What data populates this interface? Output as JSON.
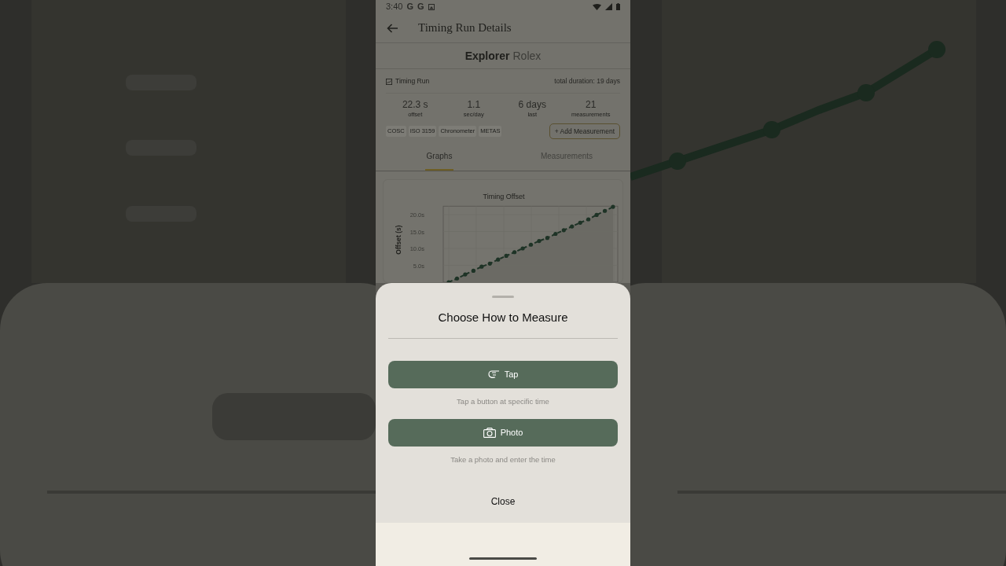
{
  "status_bar": {
    "time": "3:40",
    "notifications": [
      "G",
      "G"
    ]
  },
  "header": {
    "title": "Timing Run Details"
  },
  "watch": {
    "model": "Explorer",
    "brand": "Rolex"
  },
  "run": {
    "title": "Timing Run",
    "duration": "total duration: 19 days",
    "stats": [
      {
        "value": "22.3 s",
        "label": "offset"
      },
      {
        "value": "1.1",
        "label": "sec/day"
      },
      {
        "value": "6 days",
        "label": "last"
      },
      {
        "value": "21",
        "label": "measurements"
      }
    ],
    "tags": [
      "COSC",
      "ISO 3159",
      "Chronometer",
      "METAS"
    ],
    "add_button": "+ Add Measurement"
  },
  "tabs": [
    {
      "label": "Graphs",
      "selected": true
    },
    {
      "label": "Measurements",
      "selected": false
    }
  ],
  "chart": {
    "chart_data": {
      "type": "line",
      "title": "Timing Offset",
      "ylabel": "Offset (s)",
      "ylim": [
        0,
        22.5
      ],
      "yticks": [
        {
          "value": 20,
          "label": "20.0s"
        },
        {
          "value": 15,
          "label": "15.0s"
        },
        {
          "value": 10,
          "label": "10.0s"
        },
        {
          "value": 5,
          "label": "5.0s"
        }
      ],
      "series": [
        {
          "color": "#1e3326",
          "line_style": "dashed",
          "values": [
            0.0,
            1.1,
            2.3,
            3.4,
            4.6,
            5.5,
            6.7,
            7.8,
            8.9,
            10.0,
            11.1,
            12.2,
            13.1,
            14.3,
            15.4,
            16.5,
            17.6,
            18.6,
            19.9,
            21.1,
            22.3
          ]
        }
      ]
    }
  },
  "sheet": {
    "title": "Choose How to Measure",
    "options": [
      {
        "kind": "tap",
        "label": "Tap",
        "caption": "Tap a button at specific time"
      },
      {
        "label": "Photo",
        "caption": "Take a photo and enter the time"
      }
    ],
    "close": "Close"
  }
}
